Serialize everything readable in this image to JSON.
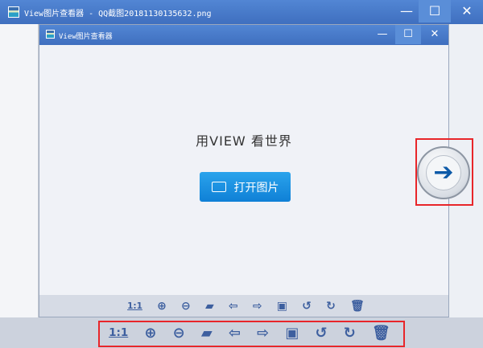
{
  "outer": {
    "title": "View图片查看器 - QQ截图20181130135632.png",
    "min": "—",
    "max": "☐",
    "close": "✕"
  },
  "inner": {
    "title": "View图片查看器",
    "min": "—",
    "max": "☐",
    "close": "✕",
    "slogan": "用VIEW 看世界",
    "open_label": "打开图片"
  },
  "toolbar": {
    "actual_size": "1:1",
    "zoom_in": "⊕",
    "zoom_out": "⊖",
    "open_folder": "▰",
    "prev": "⇦",
    "next": "⇨",
    "save": "▣",
    "rotate_left": "↺",
    "rotate_right": "↻",
    "delete": "🗑"
  },
  "next_arrow": "➔"
}
